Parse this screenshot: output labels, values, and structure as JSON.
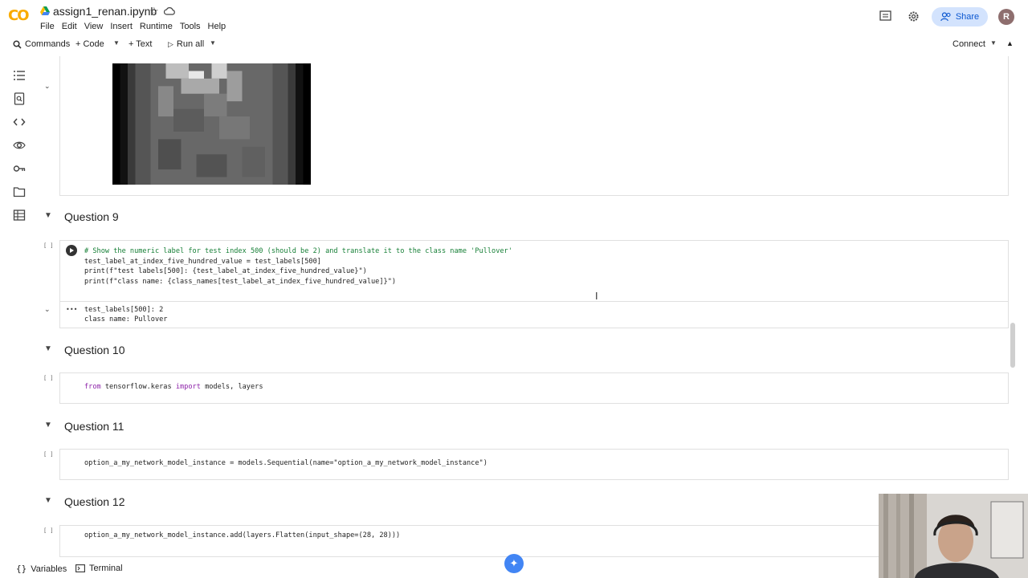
{
  "header": {
    "logo_text": "CO",
    "file_name": "assign1_renan.ipynb",
    "menu": [
      "File",
      "Edit",
      "View",
      "Insert",
      "Runtime",
      "Tools",
      "Help"
    ],
    "share_label": "Share",
    "avatar_initial": "R"
  },
  "toolbar": {
    "commands_label": "Commands",
    "code_label": "+ Code",
    "text_label": "+ Text",
    "run_all_label": "Run all",
    "connect_label": "Connect"
  },
  "sections": {
    "q9": "Question 9",
    "q10": "Question 10",
    "q11": "Question 11",
    "q12": "Question 12"
  },
  "cells": {
    "q9_code": [
      "# Show the numeric label for test index 500 (should be 2) and translate it to the class name 'Pullover'",
      "test_label_at_index_five_hundred_value = test_labels[500]",
      "print(f\"test labels[500]: {test_label_at_index_five_hundred_value}\")",
      "print(f\"class name: {class_names[test_label_at_index_five_hundred_value]}\")"
    ],
    "q9_output": [
      "test_labels[500]: 2",
      "class name: Pullover"
    ],
    "q10_code": "from tensorflow.keras import models, layers",
    "q11_code": "option_a_my_network_model_instance = models.Sequential(name=\"option_a_my_network_model_instance\")",
    "q12_code": "option_a_my_network_model_instance.add(layers.Flatten(input_shape=(28, 28)))",
    "bracket": "[ ]",
    "ellipsis": "•••"
  },
  "bottom": {
    "variables_label": "Variables",
    "terminal_label": "Terminal"
  },
  "colors": {
    "share_bg": "#d3e3fd",
    "share_fg": "#0b57d0",
    "keyword": "#8e24aa",
    "string": "#b3261e"
  }
}
